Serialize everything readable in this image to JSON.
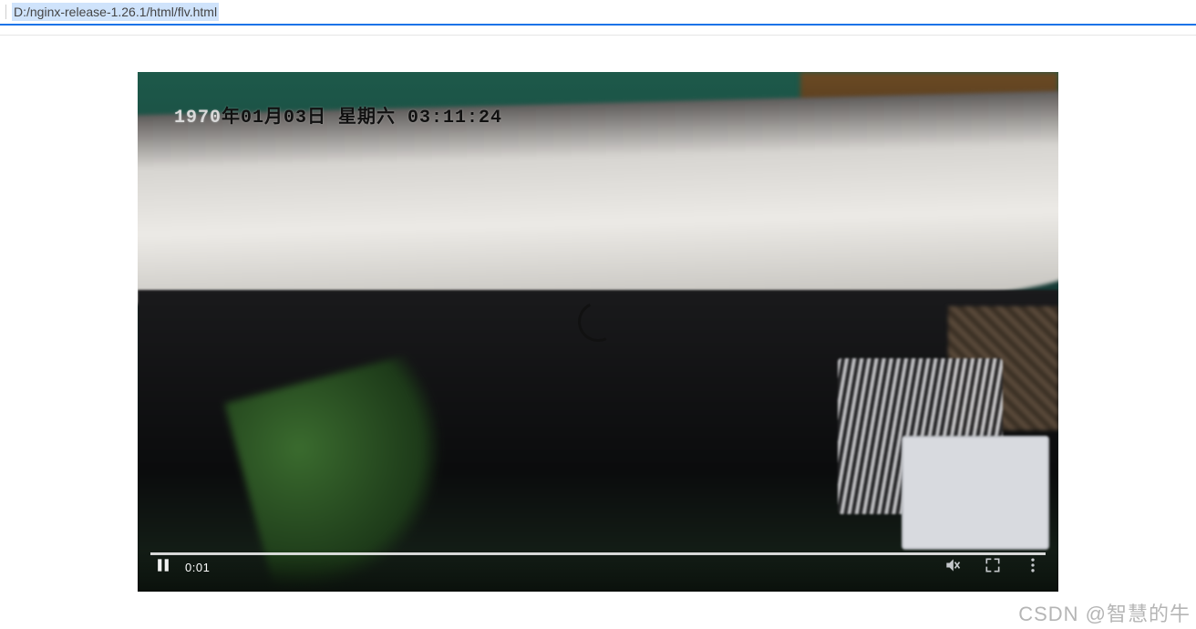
{
  "address_bar": {
    "url": "D:/nginx-release-1.26.1/html/flv.html"
  },
  "video": {
    "timestamp_overlay": {
      "year": "1970",
      "rest": "年01月03日  星期六  03:11:24"
    },
    "controls": {
      "state": "playing",
      "current_time": "0:01"
    },
    "icons": {
      "pause": "pause-icon",
      "volume_muted": "volume-muted-icon",
      "fullscreen": "fullscreen-icon",
      "more": "more-vert-icon"
    }
  },
  "watermark": "CSDN @智慧的牛"
}
